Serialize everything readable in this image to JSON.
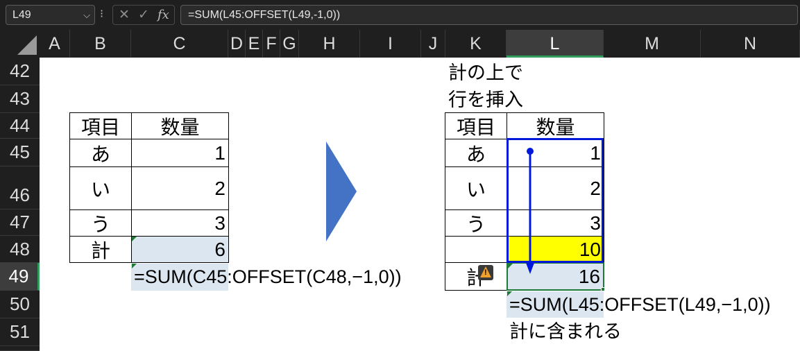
{
  "formula_bar": {
    "name_box": "L49",
    "dots": "⁝",
    "cancel": "✕",
    "enter": "✓",
    "fx": "fx",
    "formula": "=SUM(L45:OFFSET(L49,-1,0))"
  },
  "columns": [
    "A",
    "B",
    "C",
    "D",
    "E",
    "F",
    "G",
    "H",
    "I",
    "J",
    "K",
    "L",
    "M",
    "N"
  ],
  "rows": [
    "42",
    "43",
    "44",
    "45",
    "46",
    "47",
    "48",
    "49",
    "50",
    "51"
  ],
  "left_table": {
    "header_item": "項目",
    "header_qty": "数量",
    "rows": [
      {
        "item": "あ",
        "qty": "1"
      },
      {
        "item": "い",
        "qty": "2"
      },
      {
        "item": "う",
        "qty": "3"
      }
    ],
    "total_label": "計",
    "total_value": "6",
    "formula_note": "=SUM(C45:OFFSET(C48,−1,0))"
  },
  "right_table": {
    "note_line1": "計の上で",
    "note_line2": "行を挿入",
    "header_item": "項目",
    "header_qty": "数量",
    "rows": [
      {
        "item": "あ",
        "qty": "1"
      },
      {
        "item": "い",
        "qty": "2"
      },
      {
        "item": "う",
        "qty": "3"
      },
      {
        "item": "",
        "qty": "10"
      }
    ],
    "total_label": "計",
    "total_value": "16",
    "formula_note": "=SUM(L45:OFFSET(L49,−1,0))",
    "result_note": "計に含まれる"
  },
  "colors": {
    "highlight_yellow": "#ffff00",
    "selected_blue": "#dce6f1",
    "arrow_blue": "#0018d9",
    "transition_arrow": "#4472c4"
  }
}
